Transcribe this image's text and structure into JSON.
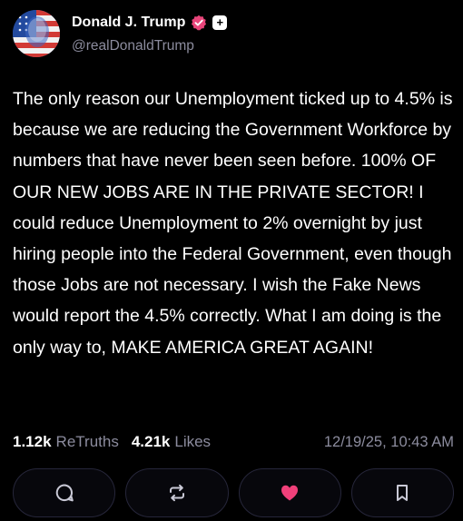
{
  "post": {
    "author": {
      "display_name": "Donald J. Trump",
      "handle": "@realDonaldTrump",
      "verified_icon": "verified-badge-icon",
      "plus_badge": "+"
    },
    "body": "The only reason our Unemployment ticked up to 4.5% is because we are reducing the Government Workforce by numbers that have never been seen before. 100% OF OUR NEW JOBS ARE IN THE PRIVATE SECTOR! I could reduce Unemployment to 2% overnight by just hiring people into the Federal Government, even though those Jobs are not necessary. I wish the Fake News would report the 4.5% correctly. What I am doing is the only way to, MAKE AMERICA GREAT AGAIN!",
    "stats": {
      "retruths_count": "1.12k",
      "retruths_label": "ReTruths",
      "likes_count": "4.21k",
      "likes_label": "Likes",
      "timestamp": "12/19/25, 10:43 AM"
    },
    "actions": [
      {
        "name": "reply",
        "icon": "comment-icon"
      },
      {
        "name": "retruth",
        "icon": "repost-icon"
      },
      {
        "name": "like",
        "icon": "heart-icon",
        "active": true
      },
      {
        "name": "bookmark",
        "icon": "bookmark-icon"
      }
    ]
  },
  "colors": {
    "background": "#000000",
    "text": "#ffffff",
    "muted": "#8c8c9e",
    "verified_badge": "#e8457a",
    "like_active": "#f0407a",
    "button_border": "#26263a"
  }
}
